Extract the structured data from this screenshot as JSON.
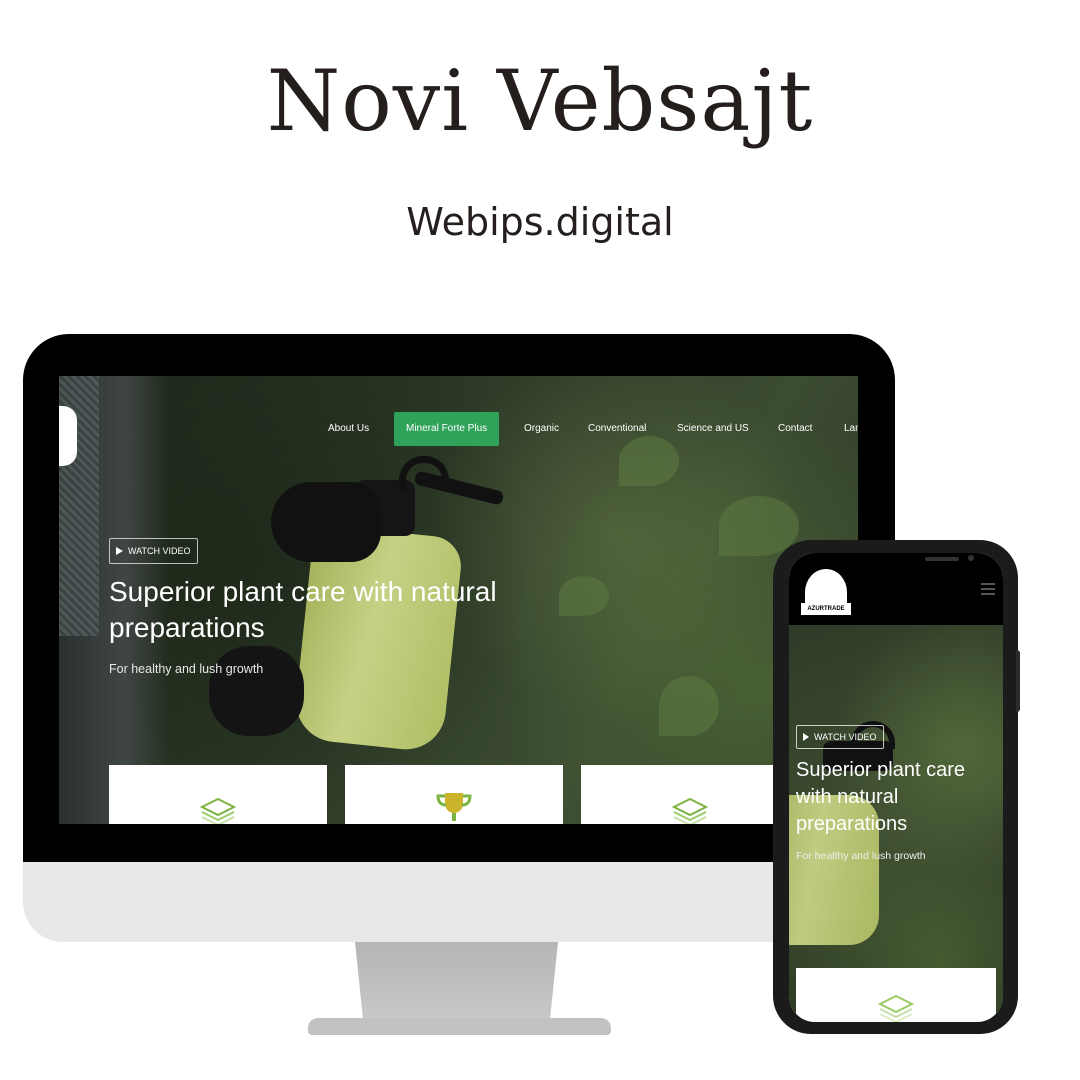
{
  "heading": {
    "title": "Novi Vebsajt",
    "subtitle": "Webips.digital"
  },
  "desktop": {
    "nav": {
      "items": [
        "About Us",
        "Mineral Forte Plus",
        "Organic",
        "Conventional",
        "Science and US",
        "Contact",
        "Lan"
      ],
      "active_index": 1
    },
    "hero": {
      "watch_video": "WATCH VIDEO",
      "title": "Superior plant care with natural preparations",
      "subtitle": "For healthy and lush growth"
    },
    "cards": [
      {
        "icon": "layers-icon"
      },
      {
        "icon": "trophy-icon"
      },
      {
        "icon": "layers-icon"
      }
    ]
  },
  "mobile": {
    "logo_text": "AZURTRADE",
    "hero": {
      "watch_video": "WATCH VIDEO",
      "title": "Superior plant care with natural preparations",
      "subtitle": "For healthy and lush growth"
    },
    "cards": [
      {
        "icon": "layers-icon"
      }
    ]
  },
  "colors": {
    "accent_green": "#2fa35a",
    "heading_text": "#241f1c",
    "icon_green": "#7cb342",
    "icon_gold": "#c9b42c"
  }
}
